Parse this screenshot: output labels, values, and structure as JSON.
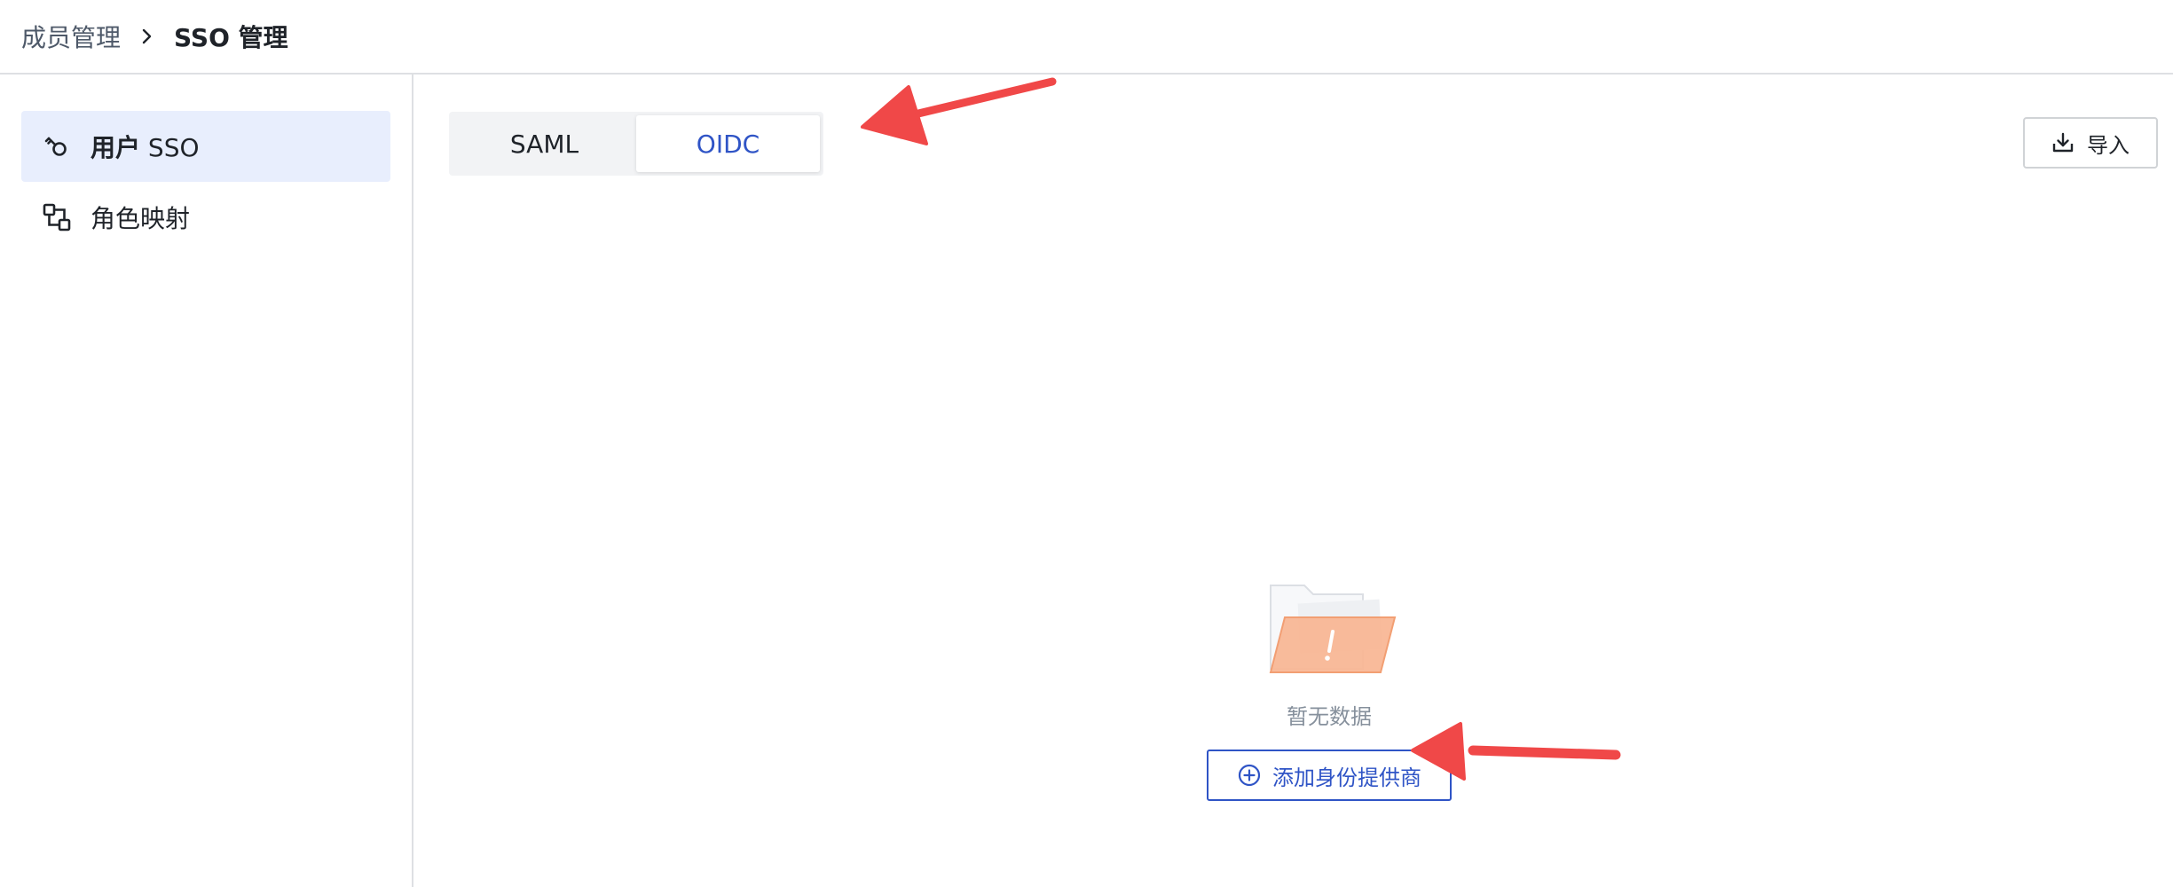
{
  "breadcrumb": {
    "parent": "成员管理",
    "current": "SSO 管理"
  },
  "sidebar": {
    "items": [
      {
        "label_strong": "用户",
        "label_rest": " SSO",
        "icon": "key-icon",
        "active": true
      },
      {
        "label_strong": "",
        "label_rest": "角色映射",
        "icon": "role-mapping-icon",
        "active": false
      }
    ]
  },
  "tabs": [
    {
      "label": "SAML",
      "active": false
    },
    {
      "label": "OIDC",
      "active": true
    }
  ],
  "toolbar": {
    "import_label": "导入",
    "import_icon": "import-icon"
  },
  "empty_state": {
    "text": "暂无数据",
    "illustration": "empty-folder-icon",
    "add_button_label": "添加身份提供商",
    "add_button_icon": "plus-circle-icon"
  },
  "colors": {
    "accent": "#2f54c6",
    "active_bg": "#e8eefd",
    "annotation_arrow": "#f04848",
    "folder": "#f9a97a"
  }
}
